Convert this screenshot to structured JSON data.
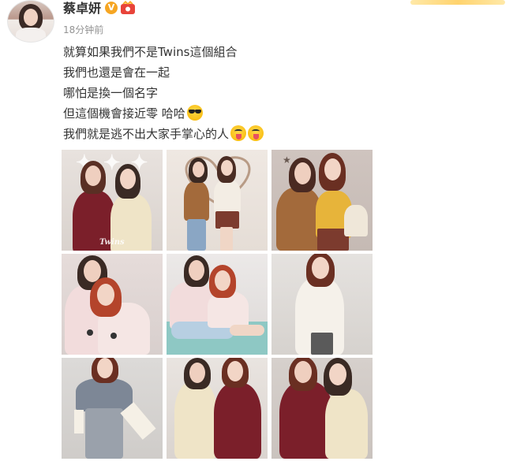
{
  "user": {
    "name": "蔡卓妍",
    "verified_badge": "V",
    "fan_badge_color": "#e8443a",
    "verified_color": "#f6a623"
  },
  "post": {
    "timestamp": "18分钟前",
    "lines": [
      "就算如果我們不是Twins這個組合",
      "我們也還是會在一起",
      "哪怕是換一個名字",
      "但這個機會接近零 哈哈",
      "我們就是逃不出大家手掌心的人"
    ],
    "line_emojis": {
      "line4": [
        "cool-sunglasses-emoji"
      ],
      "line5": [
        "tongue-out-emoji",
        "tongue-out-emoji"
      ]
    }
  },
  "photos": [
    {
      "name": "photo-1",
      "caption": "Twins"
    },
    {
      "name": "photo-2"
    },
    {
      "name": "photo-3"
    },
    {
      "name": "photo-4"
    },
    {
      "name": "photo-5"
    },
    {
      "name": "photo-6"
    },
    {
      "name": "photo-7"
    },
    {
      "name": "photo-8"
    },
    {
      "name": "photo-9"
    }
  ],
  "colors": {
    "text": "#333333",
    "meta": "#939393",
    "accent_gold": "#f6a623"
  }
}
